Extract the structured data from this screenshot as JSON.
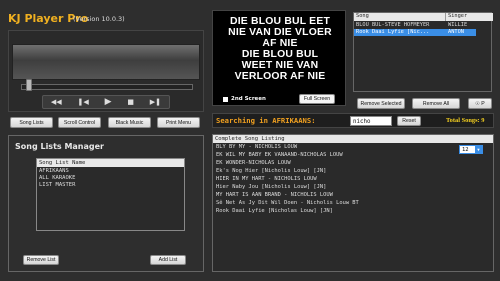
{
  "app": {
    "title": "KJ Player Pro",
    "version": "(Version 10.0.3)"
  },
  "transport": {
    "icons": [
      "rewind-icon",
      "prev-icon",
      "play-icon",
      "stop-icon",
      "next-icon"
    ]
  },
  "tabs": [
    {
      "label": "Song Lists"
    },
    {
      "label": "Scroll Control"
    },
    {
      "label": "Black Music"
    },
    {
      "label": "Print Menu"
    }
  ],
  "lyrics": {
    "lines": [
      "DIE BLOU BUL EET",
      "NIE VAN DIE VLOER",
      "AF NIE",
      "DIE BLOU BUL",
      "WEET NIE VAN",
      "VERLOOR AF NIE"
    ],
    "second_screen_label": "2nd Screen",
    "full_screen_label": "Full Screen"
  },
  "queue": {
    "headers": [
      "Song",
      "Singer"
    ],
    "rows": [
      {
        "song": "BLOU BUL-STEVE HOFMEYER",
        "singer": "WILLIE",
        "selected": false
      },
      {
        "song": "Rook Daai Lyfie [Nic...",
        "singer": "ANTON",
        "selected": true
      }
    ],
    "remove_selected_label": "Remove Selected",
    "remove_all_label": "Remove All",
    "p_label": "☉ P"
  },
  "search": {
    "label": "Searching in AFRIKAANS:",
    "value": "nicho",
    "reset_label": "Reset",
    "total_label": "Total Songs: 9"
  },
  "manager": {
    "title": "Song Lists Manager",
    "column_header": "Song List Name",
    "items": [
      "AFRIKAANS",
      "ALL KARAOKE",
      "LIST MASTER"
    ],
    "remove_label": "Remove List",
    "add_label": "Add List"
  },
  "songs": {
    "header": "Complete Song Listing",
    "items": [
      "BLY BY MY - NICHOLIS LOUW",
      "EK WIL MY BABY EK VANAAND-NICHOLAS LOUW",
      "EK WONDER-NICHOLAS LOUW",
      "Ek's Nog Hier [Nicholis Louw] [JN]",
      "HIER IN MY HART - NICHOLIS LOUW",
      "Hier Naby Jou [Nicholis Louw] [JN]",
      "MY HART IS AAN BRAND - NICHOLIS LOUW",
      "Sê Net As Jy Dit Wil Doen - Nicholis Louw BT",
      "Rook Daai Lyfie [Nicholas Louw] [JN]"
    ],
    "font_size_value": "12"
  },
  "colors": {
    "accent": "#f0b020",
    "search_label": "#f0a020",
    "total": "#f5d020",
    "selected": "#3a8ee6"
  }
}
